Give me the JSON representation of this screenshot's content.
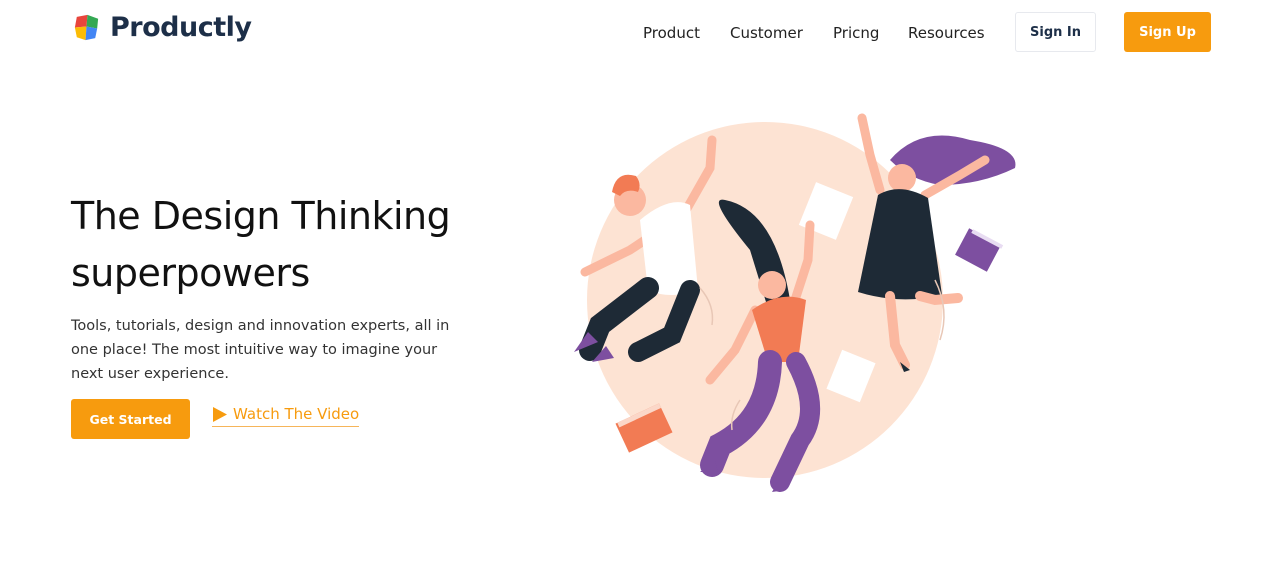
{
  "brand": {
    "name": "Productly",
    "logo_icon": "colorful-cube-logo-icon",
    "colors": [
      "#e8453c",
      "#34a853",
      "#fbbc05",
      "#4285f4"
    ]
  },
  "nav": {
    "links": [
      "Product",
      "Customer",
      "Pricng",
      "Resources"
    ],
    "sign_in": "Sign In",
    "sign_up": "Sign Up"
  },
  "hero": {
    "title_line1": "The Design Thinking",
    "title_line2": "superpowers",
    "description": "Tools, tutorials, design and innovation experts, all in one place! The most intuitive way to imagine your next user experience.",
    "cta_primary": "Get Started",
    "cta_secondary": "Watch The Video",
    "cta_secondary_icon": "play-icon"
  },
  "illustration": {
    "name": "jumping-people-illustration",
    "colors": {
      "circle": "#fde3d3",
      "shirt_orange": "#f27b54",
      "purple": "#7d4fa0",
      "dark": "#1e2a36",
      "skin": "#fbb8a0"
    }
  },
  "colors": {
    "accent": "#f79b0e",
    "heading": "#111111",
    "brand_text": "#1d2f48"
  }
}
